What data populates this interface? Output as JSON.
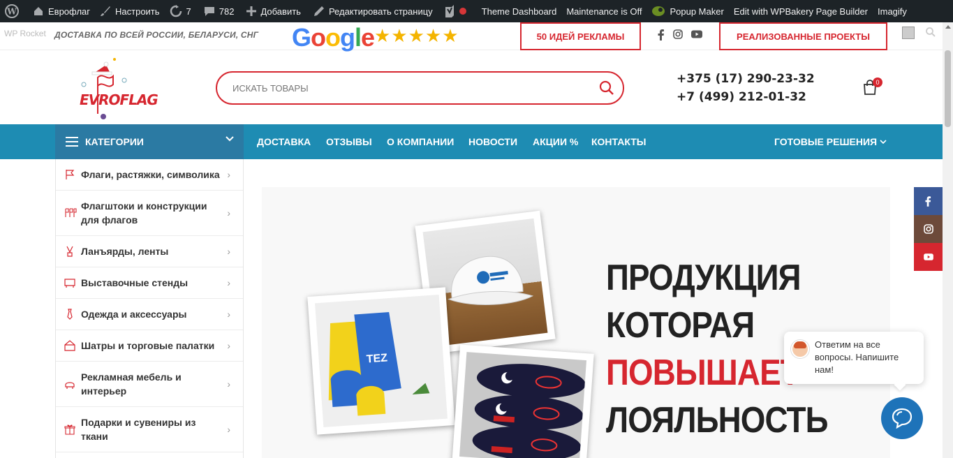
{
  "admin_bar": {
    "site_name": "Еврофлаг",
    "customize": "Настроить",
    "updates_count": "7",
    "comments_count": "782",
    "add_new": "Добавить",
    "edit_page": "Редактировать страницу",
    "theme_dashboard": "Theme Dashboard",
    "maintenance": "Maintenance is Off",
    "popup_maker": "Popup Maker",
    "wpbakery": "Edit with WPBakery Page Builder",
    "imagify": "Imagify"
  },
  "top_strip": {
    "wp_rocket": "WP Rocket",
    "delivery": "ДОСТАВКА ПО ВСЕЙ РОССИИ, БЕЛАРУСИ, СНГ",
    "google_letters": [
      "G",
      "o",
      "o",
      "g",
      "l",
      "e"
    ],
    "stars": "★★★★★",
    "ideas_button": "50 ИДЕЙ РЕКЛАМЫ",
    "projects_button": "РЕАЛИЗОВАННЫЕ ПРОЕКТЫ"
  },
  "header": {
    "logo_text": "EVROFLAG",
    "search_placeholder": "ИСКАТЬ ТОВАРЫ",
    "phone1": "+375 (17) 290-23-32",
    "phone2": "+7 (499) 212-01-32",
    "cart_count": "0"
  },
  "nav": {
    "categories_label": "КАТЕГОРИИ",
    "items": [
      "ДОСТАВКА",
      "ОТЗЫВЫ",
      "О КОМПАНИИ",
      "НОВОСТИ",
      "АКЦИИ %",
      "КОНТАКТЫ"
    ],
    "ready_solutions": "ГОТОВЫЕ РЕШЕНИЯ"
  },
  "categories": [
    {
      "label": "Флаги, растяжки, символика",
      "icon": "flag-icon"
    },
    {
      "label": "Флагштоки и конструкции для флагов",
      "icon": "flagpole-icon"
    },
    {
      "label": "Ланъярды, ленты",
      "icon": "lanyard-icon"
    },
    {
      "label": "Выставочные стенды",
      "icon": "stand-icon"
    },
    {
      "label": "Одежда и аксессуары",
      "icon": "tie-icon"
    },
    {
      "label": "Шатры и торговые палатки",
      "icon": "tent-icon"
    },
    {
      "label": "Рекламная мебель и интерьер",
      "icon": "furniture-icon"
    },
    {
      "label": "Подарки и сувениры из ткани",
      "icon": "gift-icon"
    }
  ],
  "hero": {
    "line1": "ПРОДУКЦИЯ",
    "line2": "КОТОРАЯ",
    "line3": "ПОВЫШАЕТ",
    "line4": "ЛОЯЛЬНОСТЬ"
  },
  "chat": {
    "message": "Ответим на все вопросы. Напишите нам!"
  },
  "colors": {
    "brand_red": "#d6262f",
    "nav_blue": "#1e8cb3",
    "categories_blue": "#2b7aa3",
    "admin_bar": "#1d2327"
  }
}
